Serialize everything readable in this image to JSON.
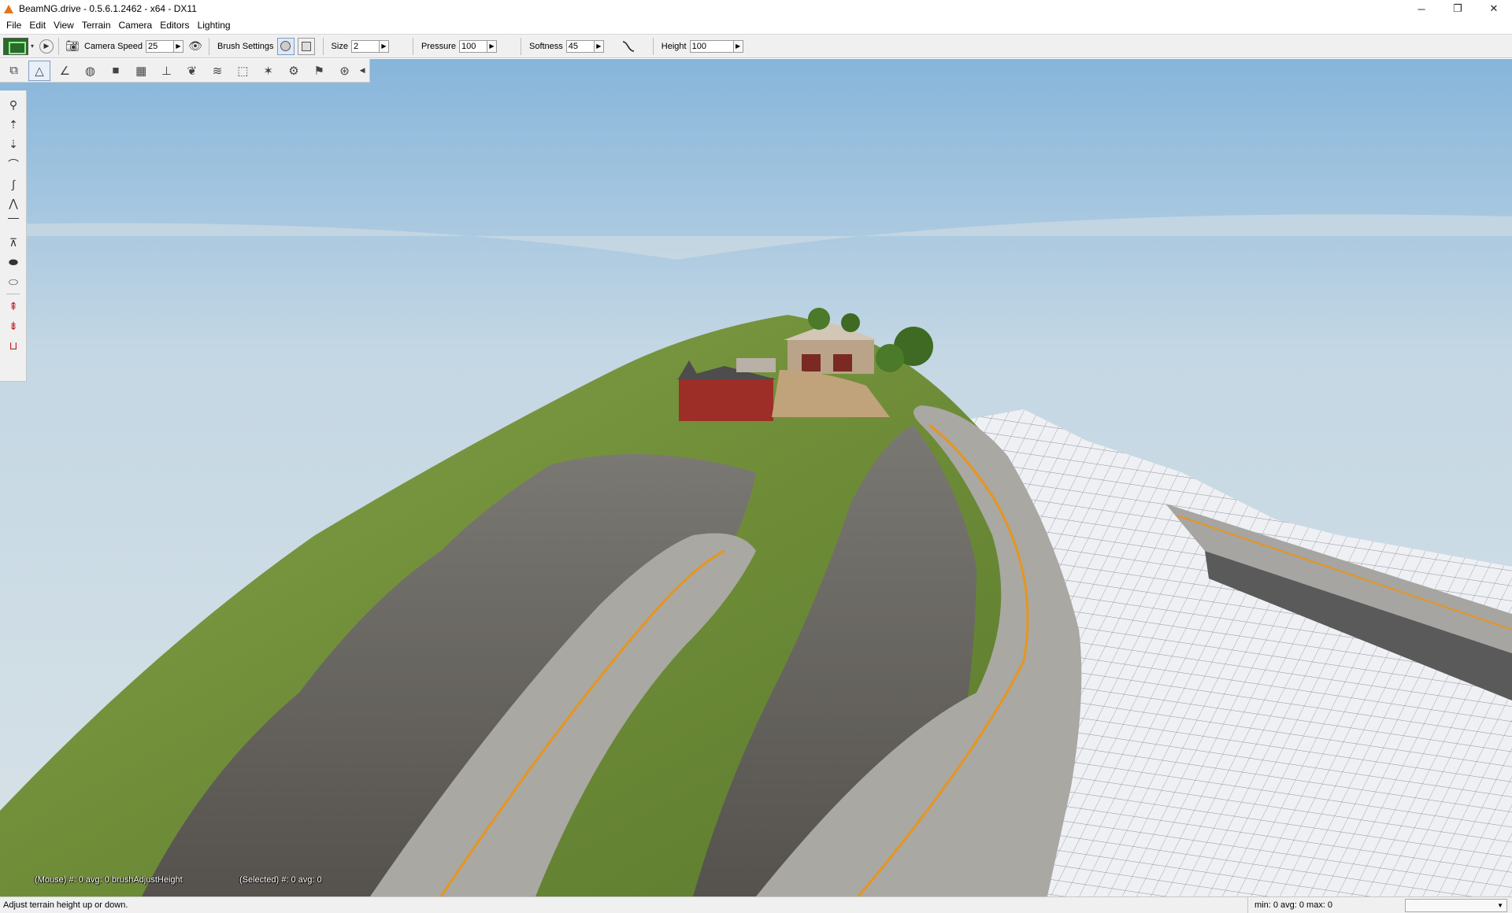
{
  "window": {
    "title": "BeamNG.drive - 0.5.6.1.2462 - x64 - DX11",
    "controls": {
      "minimize": "─",
      "restore": "❐",
      "close": "✕"
    }
  },
  "menu": [
    "File",
    "Edit",
    "View",
    "Terrain",
    "Camera",
    "Editors",
    "Lighting"
  ],
  "toolbar": {
    "camera_speed_label": "Camera Speed",
    "camera_speed_value": "25",
    "brush_settings_label": "Brush Settings",
    "size_label": "Size",
    "size_value": "2",
    "pressure_label": "Pressure",
    "pressure_value": "100",
    "softness_label": "Softness",
    "softness_value": "45",
    "height_label": "Height",
    "height_value": "100"
  },
  "viewport": {
    "mouse_info": "(Mouse) #: 0  avg: 0 brushAdjustHeight",
    "selected_info": "(Selected) #: 0  avg: 0"
  },
  "status": {
    "hint": "Adjust terrain height up or down.",
    "stats": "min: 0  avg: 0  max: 0"
  },
  "colors": {
    "sky_top": "#8ab7dc",
    "sky_bottom": "#d6e1e6",
    "grass": "#6f8f3a",
    "rock": "#6c6a66",
    "road": "#a9a8a3",
    "road_line": "#e7951f",
    "terrain_mesh": "#eef0f4"
  }
}
